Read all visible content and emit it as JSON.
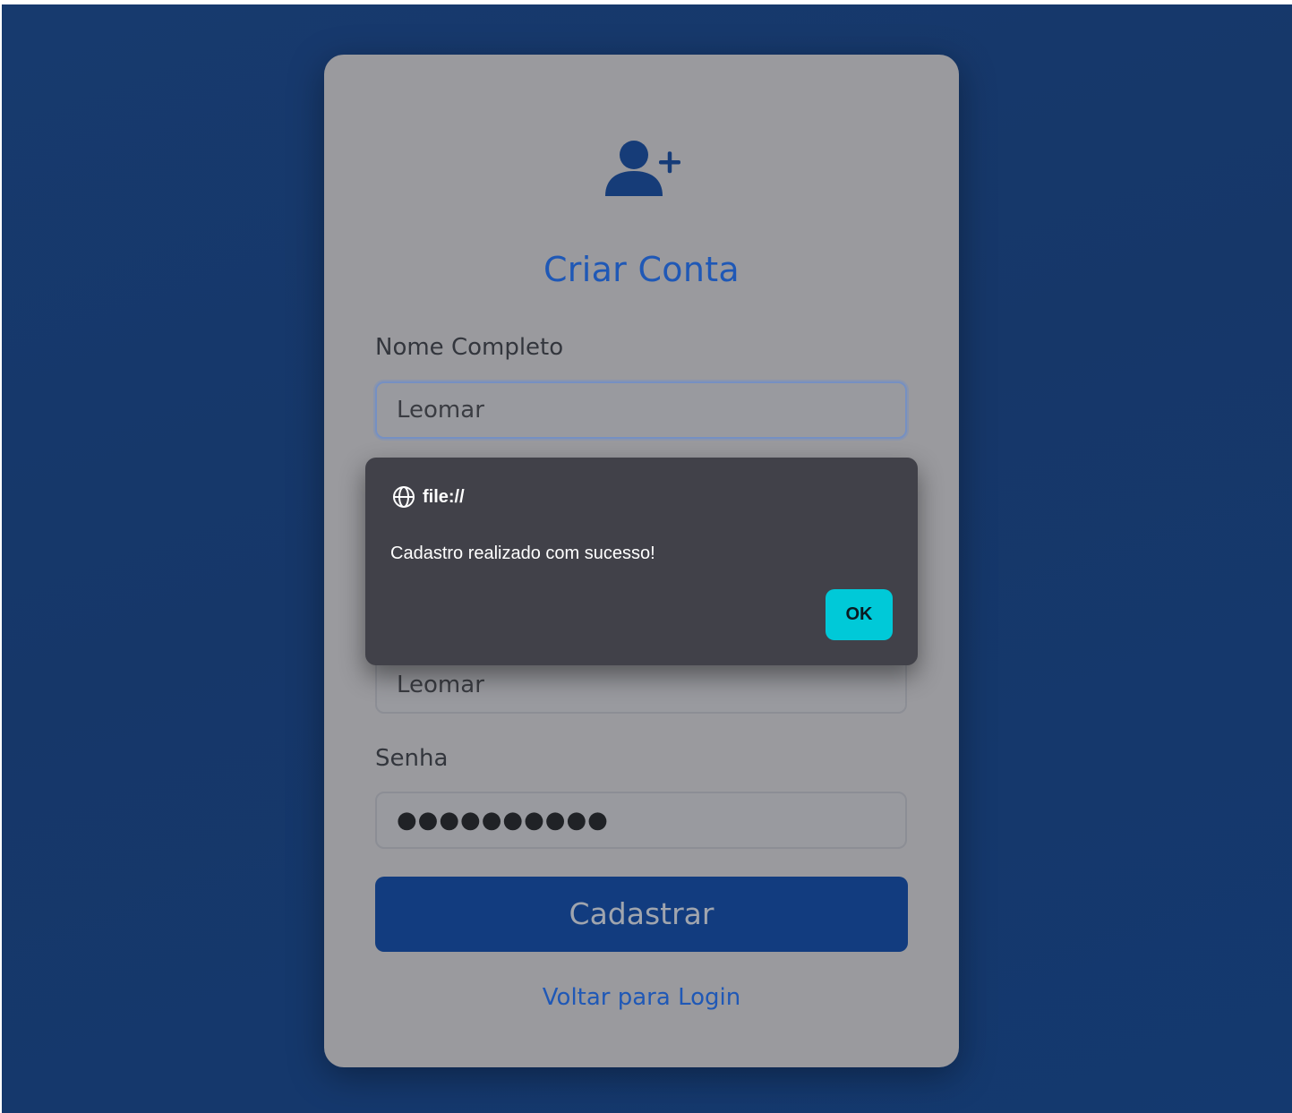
{
  "form": {
    "title": "Criar Conta",
    "name_label": "Nome Completo",
    "name_value": "Leomar",
    "second_value": "Leomar",
    "password_label": "Senha",
    "password_value": "●●●●●●●●●●",
    "submit_label": "Cadastrar",
    "back_link": "Voltar para Login",
    "icon": "user-plus-icon"
  },
  "dialog": {
    "origin": "file://",
    "origin_icon": "globe-icon",
    "message": "Cadastro realizado com sucesso!",
    "ok_label": "OK"
  },
  "colors": {
    "background": "#163769",
    "card": "#9a9a9e",
    "accent": "#1f58b6",
    "button": "#123c7f",
    "dialog": "#414149",
    "ok_button": "#00c9d8"
  }
}
